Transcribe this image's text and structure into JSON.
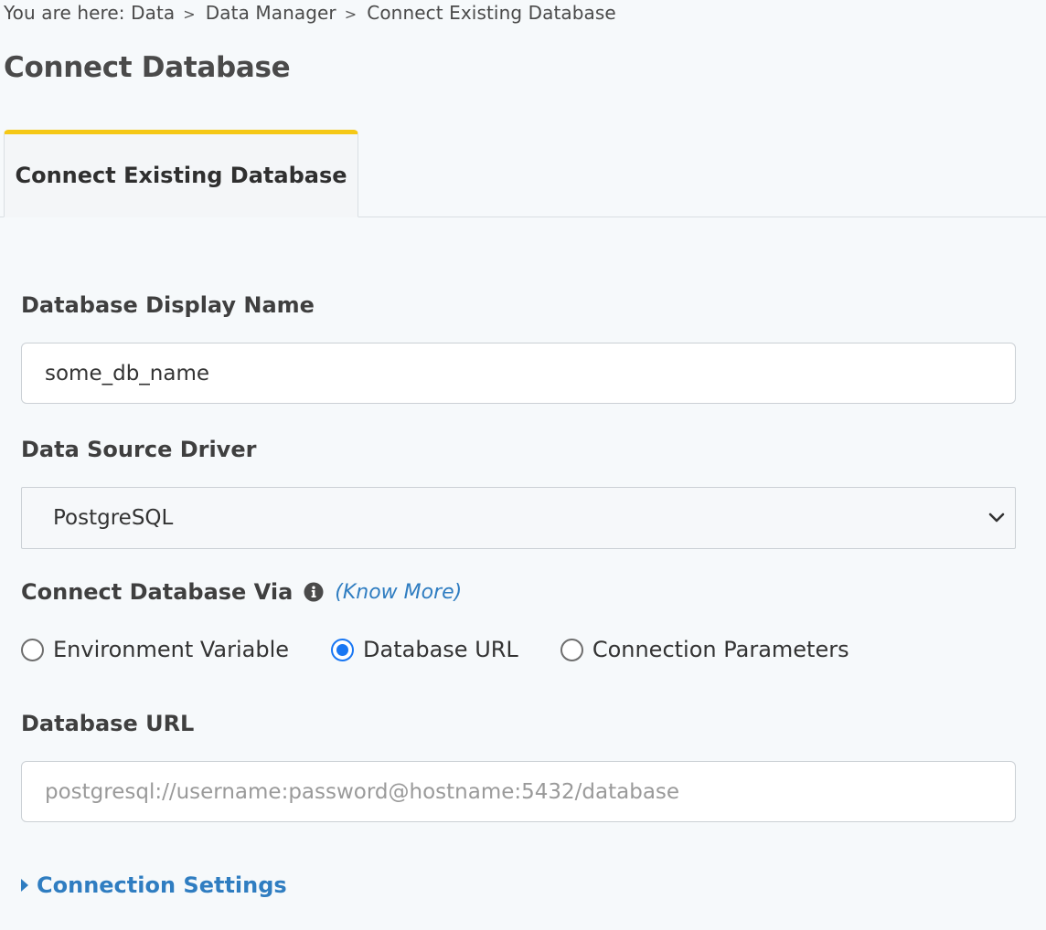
{
  "breadcrumb": {
    "prefix": "You are here:",
    "items": [
      "Data",
      "Data Manager",
      "Connect Existing Database"
    ],
    "separator": ">"
  },
  "page_title": "Connect Database",
  "tabs": [
    {
      "label": "Connect Existing Database",
      "active": true
    }
  ],
  "form": {
    "display_name": {
      "label": "Database Display Name",
      "value": "some_db_name"
    },
    "driver": {
      "label": "Data Source Driver",
      "selected": "PostgreSQL"
    },
    "connect_via": {
      "label": "Connect Database Via",
      "know_more": "(Know More)",
      "options": [
        {
          "label": "Environment Variable",
          "checked": false
        },
        {
          "label": "Database URL",
          "checked": true
        },
        {
          "label": "Connection Parameters",
          "checked": false
        }
      ]
    },
    "database_url": {
      "label": "Database URL",
      "value": "",
      "placeholder": "postgresql://username:password@hostname:5432/database"
    },
    "connection_settings": {
      "label": "Connection Settings",
      "expanded": false
    }
  },
  "colors": {
    "accent_tab": "#f5c816",
    "link": "#2f7dc1",
    "radio_checked": "#1977f3",
    "background": "#f6f9fb"
  }
}
